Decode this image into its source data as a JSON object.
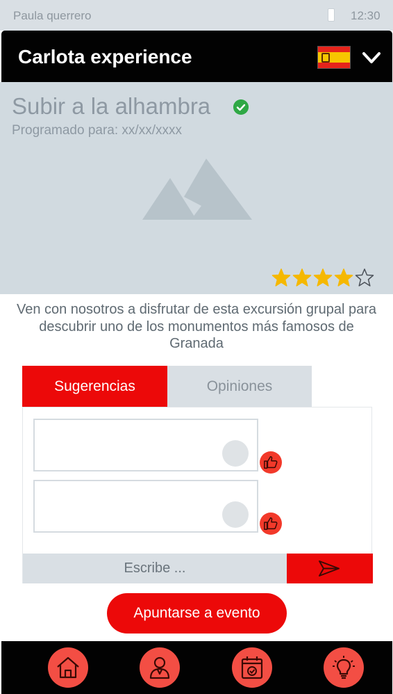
{
  "status_bar": {
    "user": "Paula querrero",
    "time": "12:30"
  },
  "header": {
    "title": "Carlota experience",
    "language_flag": "spain-flag-icon"
  },
  "event": {
    "title": "Subir a la alhambra",
    "schedule": "Programado para: xx/xx/xxxx",
    "rating": 4,
    "rating_max": 5,
    "description": "Ven con nosotros a disfrutar de esta excursión grupal para descubrir uno de los monumentos más famosos de Granada"
  },
  "tabs": [
    {
      "label": "Sugerencias",
      "active": true
    },
    {
      "label": "Opiniones",
      "active": false
    }
  ],
  "compose": {
    "placeholder": "Escribe ..."
  },
  "join_button": "Apuntarse a evento",
  "bottom_nav": [
    "home-icon",
    "user-icon",
    "calendar-icon",
    "lightbulb-icon"
  ],
  "colors": {
    "accent": "#ec0909",
    "header": "#020202",
    "hero": "#d1dae0",
    "star": "#f5b800",
    "verified": "#2fa845",
    "nav_icon_bg": "#f34e44"
  }
}
